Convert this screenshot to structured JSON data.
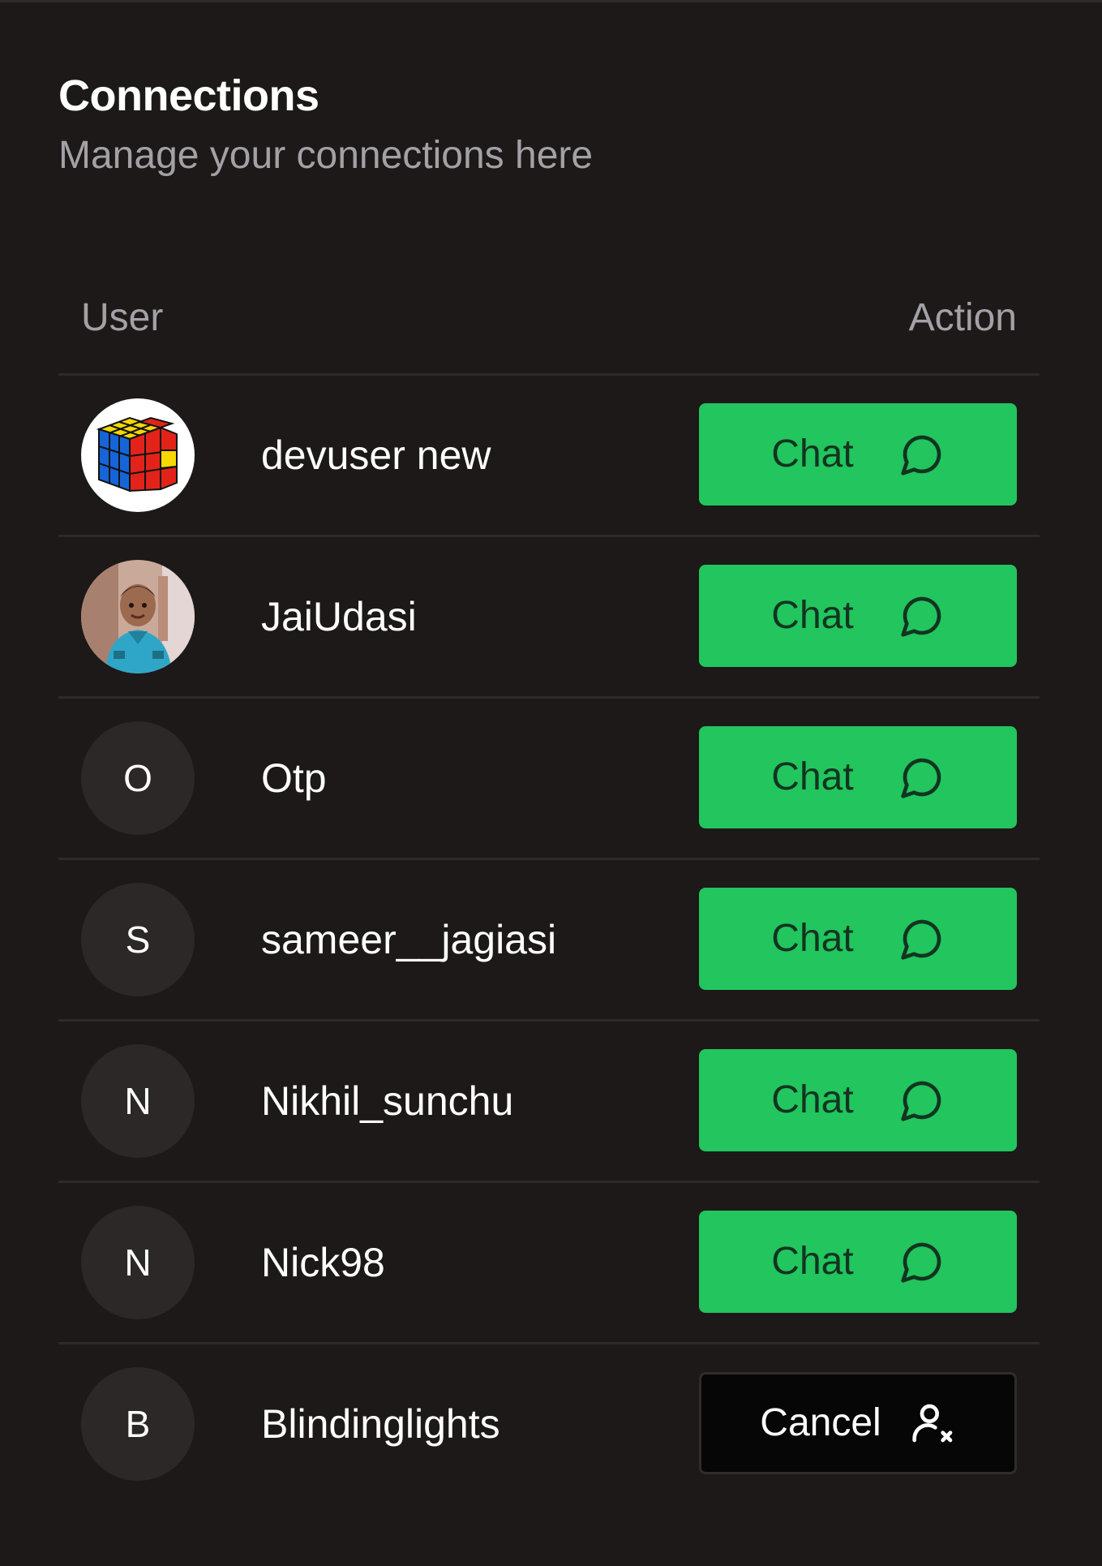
{
  "header": {
    "title": "Connections",
    "subtitle": "Manage your connections here"
  },
  "table": {
    "columns": {
      "user": "User",
      "action": "Action"
    },
    "rows": [
      {
        "name": "devuser new",
        "avatar": "rubiks-cube-image",
        "initial": "",
        "action": "Chat",
        "action_icon": "chat-bubble-icon"
      },
      {
        "name": "JaiUdasi",
        "avatar": "child-photo-image",
        "initial": "",
        "action": "Chat",
        "action_icon": "chat-bubble-icon"
      },
      {
        "name": "Otp",
        "avatar": "initial",
        "initial": "O",
        "action": "Chat",
        "action_icon": "chat-bubble-icon"
      },
      {
        "name": "sameer__jagiasi",
        "avatar": "initial",
        "initial": "S",
        "action": "Chat",
        "action_icon": "chat-bubble-icon"
      },
      {
        "name": "Nikhil_sunchu",
        "avatar": "initial",
        "initial": "N",
        "action": "Chat",
        "action_icon": "chat-bubble-icon"
      },
      {
        "name": "Nick98",
        "avatar": "initial",
        "initial": "N",
        "action": "Chat",
        "action_icon": "chat-bubble-icon"
      },
      {
        "name": "Blindinglights",
        "avatar": "initial",
        "initial": "B",
        "action": "Cancel",
        "action_icon": "user-remove-icon"
      }
    ]
  },
  "colors": {
    "background": "#1c1918",
    "chat_button": "#22c55e",
    "cancel_button": "#070606",
    "muted_text": "#a3a1a6",
    "divider": "#2d2a29"
  }
}
